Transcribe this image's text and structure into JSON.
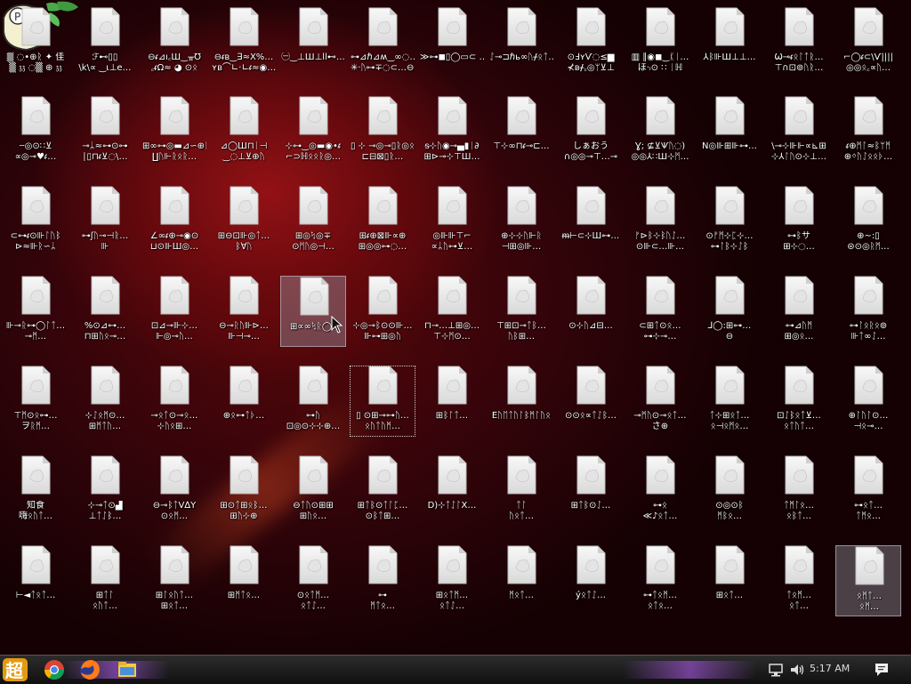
{
  "desktop": {
    "icon_kind": "file-icon",
    "rows": [
      [
        "▒ ◌•⊕ᚱ ✦ 佳\n▒ 𝔷𝔷 ◌▒ ⊕ 𝔷𝔷",
        "ℱ⊷▯▯\n\\k\\∝ ‿ι⊥e…",
        "⊖ᵳ⊿ı꜀Ш‿ᚂƱ\n꜀ᵳΩ≈ ◕ ⊙ᛟ",
        "⊖ᵳʙ‿∃≈Х%…\nʏʙ⌒∟·∟ᵳ≈◉…",
        "㊀‿⊥Ш⊥ll⊷…",
        "⊶⊿ℏ⊿ʍ‿∞◌…\n✳·ᚢ⊶∓◌⊂…⊖…",
        "≫⊶◼▯◯▭⊂ …",
        "ᛇ⊸⊐ℏь∞ᚢᚋᛟᛏ…",
        "⊙ℲʏѶ◌≤▆\n⊀ʙᚋ꜀◎ᛘ⊻⊥",
        "▥ ∥◉◼‿ᛕᛁ…\nほ·ᵢ⊙ ∷ ᛁℍ",
        "⅄ᛒ⊪Ш⊥⊥…",
        "Ѡ⊸ᵳᛟᛚᛏᚱ…\n⊤∩⊡⊚ᚢᚱ…",
        "⌐◯ᵳ⊂\\Ѵ||||\n◎◎ᛟ꜀∝ᚢ…"
      ],
      [
        "┄◎⊙∷⊻\n∝◎⊸♥ᵳ…",
        "⊸ᛦ≈⊶⊙⊶\n∣▯⊓ᵳ⊻◌\\…",
        "⊞∞⊶◎▬⊿∽⊕ᚱ\n∐ᚢ⊩ᚱᛟᚱ…",
        "⊿◯Ш⊓ᛁ⊣\n‿◌⊥⊻⊕ᚢ",
        "⊹⊶‿◎▬◉•ᵳ\n⌐⊃ℍᛟᛟᚱ◎…",
        "▯ ⊹ ⊸◎⊸▯ᚱ◎ᛟ…\n⊏⊟⊠▯ᚱ…",
        "ᵴ⊹ᚢ◉⊸▄▮ᛁ∂\n⊞⊳⊸⊹⊤Ш…",
        "⊤⊹∞⊓ᵳ⊸⊏…",
        "しぁおう\n∩◎◎⊸⊤…⊸",
        "Ɣ; ⊈⊻Ѱᚢ◌)\n◎◎⅄∷Ш⊹ᛗ…",
        "Ν◎⊪⊞⊪⊶…",
        "\\⊸⊹⊪⊩∝⊾⊞\n⊹⅄ᛚᚢ⊙⊹⊥…",
        "ᵳ⊕ᛗᛚ≈ᛒᛘᛗ\n⊕ᛜᚢᛇᛟᛟᚦ…"
      ],
      [
        "⊂⊶ᵳ⊙⊪ᛚᚢᛒ\n⊳≈⊪ᚱ∽ᛦ",
        "⊶ʃᚢ⊸⊣ᚱ…\n⊪",
        "∠∞ᵳ⊕⊸◉⊙\n⊔⊙⊪Ш◎…",
        "⊞⊖⊡⊪◎ᛏ…\nᛒ∀ᚢ",
        "⊞◎ᛪ◎∓\n⊙ᛗᚢ◎⊣…",
        "⊞ᵳ⊕⊠⊪∝⊕\n⊞◎◎⊶◌…",
        "◎⊪⊪⊤⌐\n∝ᛦᚢ⊶⊻…",
        "⊕⊹⊹ᚢ⊩ᚱ\n⊣⊞◎⊪…",
        "ᵯ⊢⊂⊹Ш⊶…",
        "ᚠ⊳ᛒ⊹ᛒᚢᛇ…\n⊙⊪⊂…⊪…",
        "⊙ᚠᛗ⊹ᛈ⊹…\n⊶ᛚᛒ⊹ᛇᛒ",
        "⊶ᛒサ\n⊞⊹◌…",
        "⊕∼:▯\n⊜⊙◎ᚱᛗ…"
      ],
      [
        "⊪⊸ᚱ⊶◯ᛚᛏ…\n⊸ᛗ…",
        "%⊙⊿⊶…\n⊓⊞ᚢᛟ⊸…",
        "⊡⊿⊸⊪⊹…\n⊩◎⊸ᚢ…",
        "⊖⊸ᚱᚢ⊪⊳…\n⊪⊣⊸…",
        "⊞∝∞ᛪᚱ◯A",
        "⊹◎⊸ᛒ⊙⊙⊪…\n⊪⊶⊞◎ᚢ",
        "⊓⊸…⊥⊞◎…\n⊤⊹ᛗ⊙…",
        "⊤⊞⊡⊸ᛏᛒ…\nᚢᛒ⊞…",
        "⊙⊹ᚢ⊿⊟…",
        "⊂⊞ᛏ⊙ᛟ…\n⊶⊹⊸…",
        "⅃◯:⊞⊶…\n⊖",
        "⊶⊿ᚢᛗ\n⊞◎ᛟ…",
        "⊶ᛚᛟᚱᛟ⊚\n⊪ᛏ∞ᛇ…"
      ],
      [
        "⊤ᛗ⊙ᛟ⊶…\nヲᚱᛗ…",
        "⊹ᛇᛟᛗ⊙…\n⊞ᛗᛏᚢ…",
        "⊸ᛟᛏ⊙⊸ᛟ…\n⊹ᚢᛟ⊞…",
        "⊕ᛟ⊶ᛏᚦ…",
        "⊶ᚢ\n⊡◎⊙⊹⊹⊕…",
        "▯ ⊙⊞⊸⊶ᚢ…\nᛟᚢᛏᚢᛗ…",
        "⊞ᛒᛚᛏ…",
        "Êᚢᛖᛏᚢᛚᛒᛗᛚᚢᛟ",
        "⊙⊙ᛟ∝ᛏᛇᛒ…",
        "⊸ᛗᚢ⊙⊸ᛟᛏ…\nさ⊕",
        "ᛏ⊹⊞ᛟᛏ…\nᛟ⊣ᛟᛗᛟ…",
        "⊡ᛇᛒᛟᛏ⊻…\nᛟᛏᚢᛏ…",
        "⊕ᛚᚢᛚ⊙…\n⊣ᛟ⊸…"
      ],
      [
        "知食\n嗨ᛟᚢᛏ…",
        "⊹⊸ᛏ⊙▟\n⊥ᛏᛇᛒ…",
        "⊖⊸ᛒᛏV∆Y\n⊙ᛟᛗ…",
        "⊞⊙ᛏ⊞ᛟᛒ…\n⊞ᚢ⊹⊕",
        "⊖ᛏᚢ⊙⊞⊞\n⊞ᚢᛟ…",
        "⊞ᛏᛒ⊙ᛏᛚᛈ…\n⊙ᛒᛏ⊞…",
        "D)⊹ᛏᛇᛚX…",
        "ᛏᛚ\nᚢᛟᛏ…",
        "⊞ᛏᛒ⊙ᛇ…",
        "⊶ᛟ\n≪♪ᛟᛏ…",
        "⊙◎⊙ᛒ\nᛗᛒᛟ…",
        "ᛏᛗᛚᛟ…\nᛟᛒᛏ…",
        "⊶ᛟᛏ…\nᛏᛗᛟ…"
      ],
      [
        "⊢◄ᛏᛟᛏ…",
        "⊞ᛏᛚ\nᛟᚢᛏ…",
        "⊞ᛚᛟᚢᛏ…\n⊞ᛟᛏ…",
        "⊞ᛗᛏᛟ…",
        "⊙ᛟᛏᛗ…\nᛟᛏᛇ…",
        "⊶\nᛗᛏᛟ…",
        "⊞ᛟᛏᛗ…\nᛟᛏᛇ…",
        "ᛗᛟᛏ…",
        "ýᛟᛏᛇ…",
        "⊶ᛏᛟᛗ…\nᛟᛏᛟ…",
        "⊞ᛟᛏ…",
        "ᛏᛟᛗ…\nᛟᛏ…",
        "ᛟᛗᛏ…\nᛟᛗ…"
      ]
    ]
  },
  "taskbar": {
    "clock": "5:17 AM"
  }
}
